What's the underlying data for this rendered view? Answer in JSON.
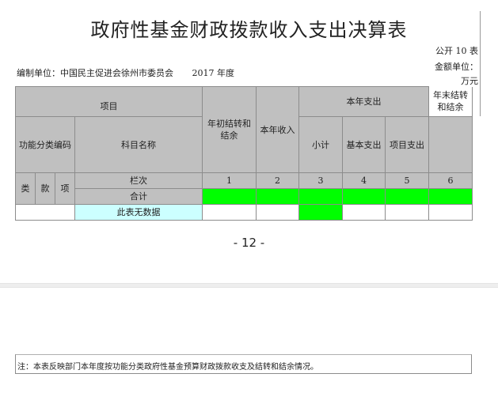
{
  "title": "政府性基金财政拨款收入支出决算表",
  "form_code": "公开 10 表",
  "amount_unit_label": "金额单位：",
  "amount_unit": "万元",
  "org_label": "编制单位：中国民主促进会徐州市委员会",
  "year": "2017 年度",
  "table": {
    "col_item": "项目",
    "col_opening_balance": "年初结转和结余",
    "col_income": "本年收入",
    "col_expense_group": "本年支出",
    "col_closing_balance": "年末结转和结余",
    "col_func_code": "功能分类编码",
    "col_subject_name": "科目名称",
    "col_subtotal": "小计",
    "col_basic_expense": "基本支出",
    "col_project_expense": "项目支出",
    "col_class": "类",
    "col_section": "款",
    "col_item_code": "项",
    "row_column_no": "栏次",
    "column_numbers": [
      "1",
      "2",
      "3",
      "4",
      "5",
      "6"
    ],
    "row_total": "合计",
    "row_nodata": "此表无数据"
  },
  "page_number": "- 12 -",
  "note": "注：本表反映部门本年度按功能分类政府性基金预算财政拨款收支及结转和结余情况。",
  "colors": {
    "header_gray": "#c0c0c0",
    "total_green": "#00ff00",
    "nodata_cyan": "#ccffff"
  }
}
